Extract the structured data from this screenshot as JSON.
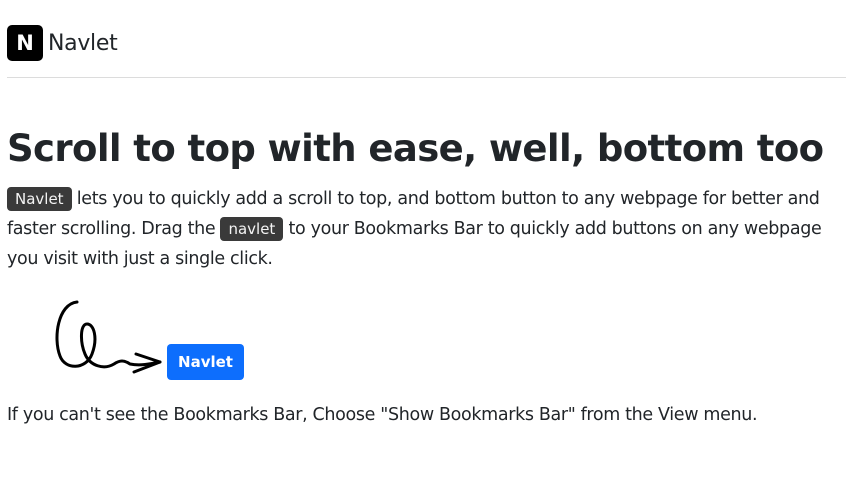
{
  "navbar": {
    "logo_letter": "N",
    "brand": "Navlet"
  },
  "hero": {
    "title": "Scroll to top with ease, well, bottom too",
    "intro": {
      "chip1": "Navlet",
      "text1": " lets you to quickly add a scroll to top, and bottom button to any webpage for better and faster scrolling. Drag the ",
      "chip2": "navlet",
      "text2": " to your Bookmarks Bar to quickly add buttons on any webpage you visit with just a single click."
    },
    "bookmarklet_label": "Navlet",
    "footnote": "If you can't see the Bookmarks Bar, Choose \"Show Bookmarks Bar\" from the View menu."
  },
  "colors": {
    "accent": "#0d6efd",
    "chip_bg": "#3a3a3a",
    "divider": "#dcdcdc"
  },
  "icons": {
    "logo": "n-logo-icon",
    "arrow": "swirl-arrow-icon"
  }
}
